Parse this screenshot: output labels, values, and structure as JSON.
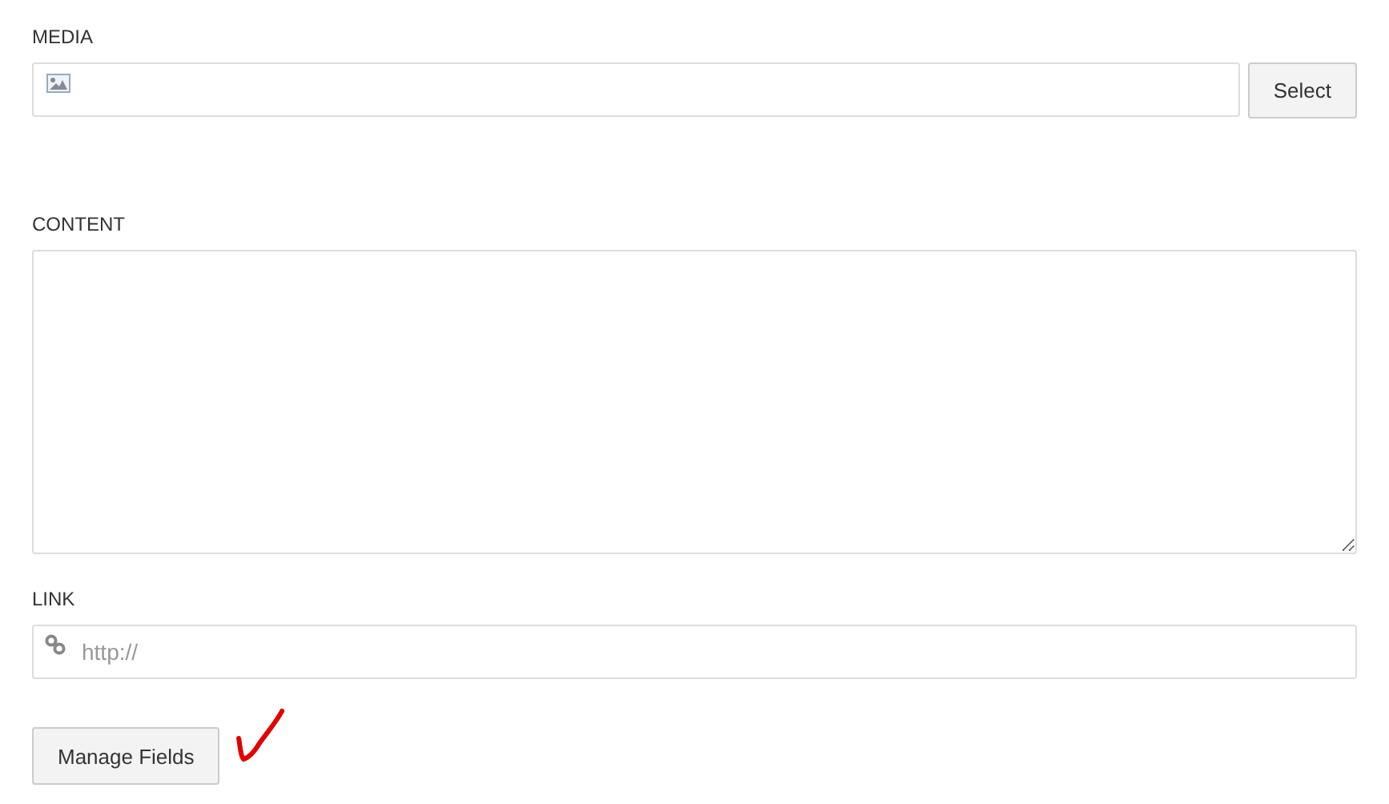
{
  "media": {
    "label": "MEDIA",
    "button": "Select"
  },
  "content": {
    "label": "CONTENT"
  },
  "link": {
    "label": "LINK",
    "placeholder": "http://"
  },
  "manage_button": "Manage Fields"
}
